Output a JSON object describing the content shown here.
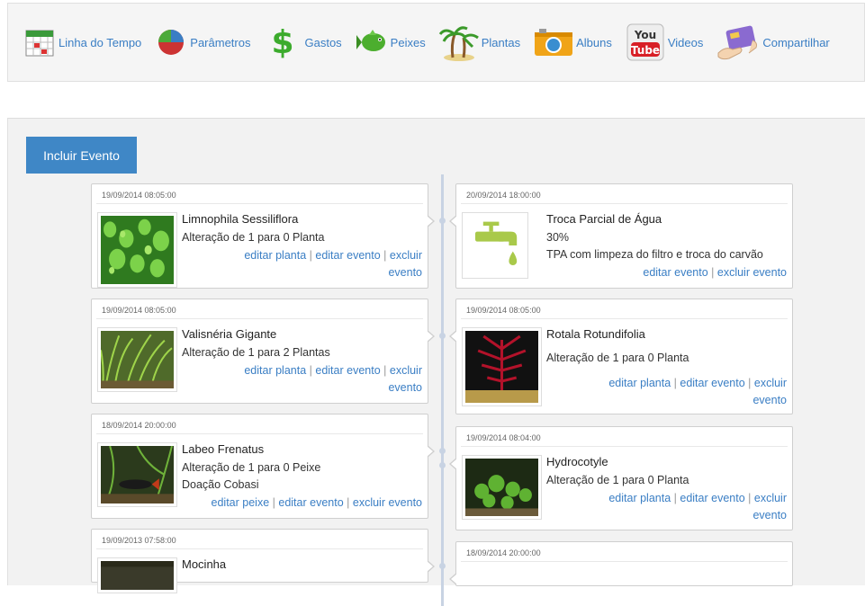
{
  "nav": {
    "items": [
      {
        "label": "Linha do Tempo",
        "icon": "calendar-icon"
      },
      {
        "label": "Parâmetros",
        "icon": "pie-chart-icon"
      },
      {
        "label": "Gastos",
        "icon": "dollar-icon"
      },
      {
        "label": "Peixes",
        "icon": "fish-icon"
      },
      {
        "label": "Plantas",
        "icon": "palm-tree-icon"
      },
      {
        "label": "Albuns",
        "icon": "camera-icon"
      },
      {
        "label": "Videos",
        "icon": "youtube-icon"
      },
      {
        "label": "Compartilhar",
        "icon": "share-card-icon"
      }
    ]
  },
  "toolbar": {
    "add_event_label": "Incluir Evento"
  },
  "sep": "|",
  "links": {
    "edit_plant": "editar planta",
    "edit_fish": "editar peixe",
    "edit_event": "editar evento",
    "delete_event": "excluir evento",
    "delete_word": "excluir",
    "event_word": "evento"
  },
  "left_events": [
    {
      "date": "19/09/2014 08:05:00",
      "title": "Limnophila Sessiliflora",
      "line1": "Alteração de 1 para 0 Planta",
      "line2": ""
    },
    {
      "date": "19/09/2014 08:05:00",
      "title": "Valisnéria Gigante",
      "line1": "Alteração de 1 para 2 Plantas",
      "line2": ""
    },
    {
      "date": "18/09/2014 20:00:00",
      "title": "Labeo Frenatus",
      "line1": "Alteração de 1 para 0 Peixe",
      "line2": "Doação Cobasi"
    },
    {
      "date": "19/09/2013 07:58:00",
      "title": "Mocinha",
      "line1": "",
      "line2": ""
    }
  ],
  "right_events": [
    {
      "date": "20/09/2014 18:00:00",
      "title": "Troca Parcial de Água",
      "line1": "30%",
      "line2": "TPA com limpeza do filtro e troca do carvão"
    },
    {
      "date": "19/09/2014 08:05:00",
      "title": "Rotala Rotundifolia",
      "line1": "Alteração de 1 para 0 Planta",
      "line2": ""
    },
    {
      "date": "19/09/2014 08:04:00",
      "title": "Hydrocotyle",
      "line1": "Alteração de 1 para 0 Planta",
      "line2": ""
    },
    {
      "date": "18/09/2014 20:00:00",
      "title": "",
      "line1": "",
      "line2": ""
    }
  ],
  "colors": {
    "accent": "#3f87c6",
    "link": "#3a7ec4",
    "faucet": "#a9c94a"
  }
}
